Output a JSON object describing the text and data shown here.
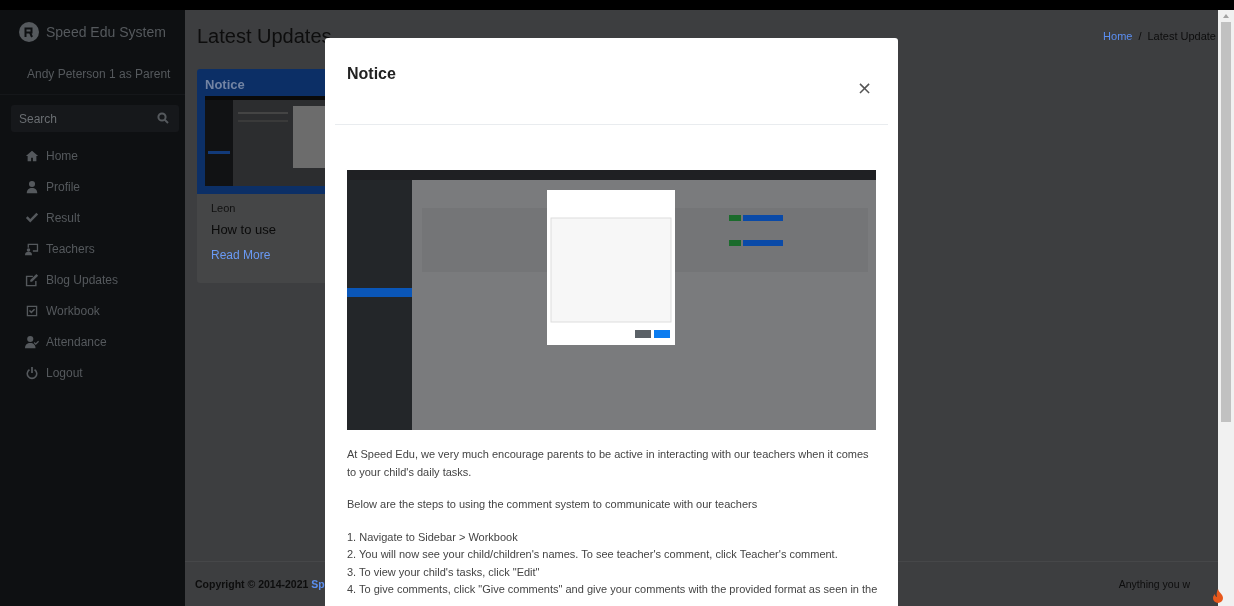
{
  "sidebar": {
    "brand": "Speed Edu System",
    "user": "Andy Peterson 1 as Parent",
    "search": {
      "placeholder": "Search"
    },
    "items": [
      {
        "label": "Home"
      },
      {
        "label": "Profile"
      },
      {
        "label": "Result"
      },
      {
        "label": "Teachers"
      },
      {
        "label": "Blog Updates"
      },
      {
        "label": "Workbook"
      },
      {
        "label": "Attendance"
      },
      {
        "label": "Logout"
      }
    ]
  },
  "page": {
    "title": "Latest Updates",
    "breadcrumb": [
      "Home",
      "/",
      "Latest Update"
    ],
    "card": {
      "header": "Notice",
      "author": "Leon",
      "title": "How to use",
      "link": "Read More"
    }
  },
  "footer": {
    "copyright": "Copyright © 2014-2021",
    "link": "Sp",
    "right": "Anything you w"
  },
  "modal": {
    "title": "Notice",
    "close": "×",
    "paragraphs": [
      "At Speed Edu, we very much encourage parents to be active in interacting with our teachers when it comes to your child's daily tasks.",
      "Below are the steps to using the comment system to communicate with our teachers"
    ],
    "steps": [
      "1. Navigate to Sidebar > Workbook",
      "2. You will now see your child/children's names. To see teacher's comment, click Teacher's comment.",
      "3. To view your child's tasks, click \"Edit\"",
      "4. To give comments, click \"Give comments\" and give your comments with the provided format as seen in the"
    ]
  }
}
